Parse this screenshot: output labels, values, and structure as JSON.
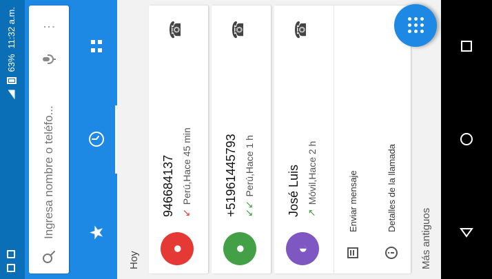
{
  "status_bar": {
    "battery_percent": "63%",
    "time": "11:32 a.m."
  },
  "search": {
    "placeholder": "Ingresa nombre o teléfo..."
  },
  "tabs": [
    {
      "label": "favorites",
      "icon": "star-icon"
    },
    {
      "label": "recent",
      "icon": "clock-icon"
    },
    {
      "label": "contacts",
      "icon": "contacts-icon"
    }
  ],
  "content": {
    "section_today": "Hoy",
    "older_label": "Más antiguos"
  },
  "calls": [
    {
      "name": "946684137",
      "detail": "Perú,Hace 45 min",
      "avatar_color": "#e53935",
      "direction": "missed"
    },
    {
      "name": "+51961445793",
      "detail": "Perú,Hace 1 h",
      "avatar_color": "#43a047",
      "direction": "incoming"
    },
    {
      "name": "José Luis",
      "detail": "Móvil,Hace 2 h",
      "avatar_color": "#7e57c2",
      "direction": "outgoing"
    }
  ],
  "expanded_actions": [
    {
      "label": "Enviar mensaje",
      "icon": "message-icon"
    },
    {
      "label": "Detalles de la llamada",
      "icon": "info-icon"
    }
  ],
  "colors": {
    "primary": "#1e88e5",
    "status_bar": "#0b6fb8",
    "missed": "#e53935",
    "incoming": "#43a047",
    "outgoing": "#7e57c2"
  }
}
